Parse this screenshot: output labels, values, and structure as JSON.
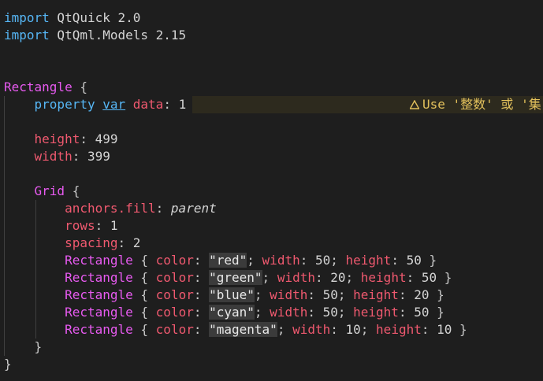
{
  "editor": {
    "warning_text": "Use '整数' 或 '集",
    "lines": [
      {
        "tokens": [
          [
            "kw",
            "import"
          ],
          [
            "id",
            " QtQuick 2.0"
          ]
        ]
      },
      {
        "tokens": [
          [
            "kw",
            "import"
          ],
          [
            "id",
            " QtQml.Models 2.15"
          ]
        ]
      },
      {
        "tokens": []
      },
      {
        "tokens": []
      },
      {
        "tokens": [
          [
            "type",
            "Rectangle"
          ],
          [
            "punc",
            " {"
          ]
        ]
      },
      {
        "tokens": [
          [
            "id",
            "    "
          ],
          [
            "pkw",
            "property"
          ],
          [
            "id",
            " "
          ],
          [
            "var",
            "var"
          ],
          [
            "id",
            " "
          ],
          [
            "prop",
            "data"
          ],
          [
            "punc",
            ": "
          ],
          [
            "num",
            "1"
          ]
        ]
      },
      {
        "tokens": []
      },
      {
        "tokens": [
          [
            "id",
            "    "
          ],
          [
            "prop",
            "height"
          ],
          [
            "punc",
            ": "
          ],
          [
            "num",
            "499"
          ]
        ]
      },
      {
        "tokens": [
          [
            "id",
            "    "
          ],
          [
            "prop",
            "width"
          ],
          [
            "punc",
            ": "
          ],
          [
            "num",
            "399"
          ]
        ]
      },
      {
        "tokens": []
      },
      {
        "tokens": [
          [
            "id",
            "    "
          ],
          [
            "type",
            "Grid"
          ],
          [
            "punc",
            " {"
          ]
        ]
      },
      {
        "tokens": [
          [
            "id",
            "        "
          ],
          [
            "prop",
            "anchors.fill"
          ],
          [
            "punc",
            ": "
          ],
          [
            "parent",
            "parent"
          ]
        ]
      },
      {
        "tokens": [
          [
            "id",
            "        "
          ],
          [
            "prop",
            "rows"
          ],
          [
            "punc",
            ": "
          ],
          [
            "num",
            "1"
          ]
        ]
      },
      {
        "tokens": [
          [
            "id",
            "        "
          ],
          [
            "prop",
            "spacing"
          ],
          [
            "punc",
            ": "
          ],
          [
            "num",
            "2"
          ]
        ]
      },
      {
        "tokens": [
          [
            "id",
            "        "
          ],
          [
            "type",
            "Rectangle"
          ],
          [
            "punc",
            " { "
          ],
          [
            "prop",
            "color"
          ],
          [
            "punc",
            ": "
          ],
          [
            "str",
            "\"red\""
          ],
          [
            "punc",
            "; "
          ],
          [
            "prop",
            "width"
          ],
          [
            "punc",
            ": "
          ],
          [
            "num",
            "50"
          ],
          [
            "punc",
            "; "
          ],
          [
            "prop",
            "height"
          ],
          [
            "punc",
            ": "
          ],
          [
            "num",
            "50"
          ],
          [
            "punc",
            " }"
          ]
        ]
      },
      {
        "tokens": [
          [
            "id",
            "        "
          ],
          [
            "type",
            "Rectangle"
          ],
          [
            "punc",
            " { "
          ],
          [
            "prop",
            "color"
          ],
          [
            "punc",
            ": "
          ],
          [
            "str",
            "\"green\""
          ],
          [
            "punc",
            "; "
          ],
          [
            "prop",
            "width"
          ],
          [
            "punc",
            ": "
          ],
          [
            "num",
            "20"
          ],
          [
            "punc",
            "; "
          ],
          [
            "prop",
            "height"
          ],
          [
            "punc",
            ": "
          ],
          [
            "num",
            "50"
          ],
          [
            "punc",
            " }"
          ]
        ]
      },
      {
        "tokens": [
          [
            "id",
            "        "
          ],
          [
            "type",
            "Rectangle"
          ],
          [
            "punc",
            " { "
          ],
          [
            "prop",
            "color"
          ],
          [
            "punc",
            ": "
          ],
          [
            "str",
            "\"blue\""
          ],
          [
            "punc",
            "; "
          ],
          [
            "prop",
            "width"
          ],
          [
            "punc",
            ": "
          ],
          [
            "num",
            "50"
          ],
          [
            "punc",
            "; "
          ],
          [
            "prop",
            "height"
          ],
          [
            "punc",
            ": "
          ],
          [
            "num",
            "20"
          ],
          [
            "punc",
            " }"
          ]
        ]
      },
      {
        "tokens": [
          [
            "id",
            "        "
          ],
          [
            "type",
            "Rectangle"
          ],
          [
            "punc",
            " { "
          ],
          [
            "prop",
            "color"
          ],
          [
            "punc",
            ": "
          ],
          [
            "str",
            "\"cyan\""
          ],
          [
            "punc",
            "; "
          ],
          [
            "prop",
            "width"
          ],
          [
            "punc",
            ": "
          ],
          [
            "num",
            "50"
          ],
          [
            "punc",
            "; "
          ],
          [
            "prop",
            "height"
          ],
          [
            "punc",
            ": "
          ],
          [
            "num",
            "50"
          ],
          [
            "punc",
            " }"
          ]
        ]
      },
      {
        "tokens": [
          [
            "id",
            "        "
          ],
          [
            "type",
            "Rectangle"
          ],
          [
            "punc",
            " { "
          ],
          [
            "prop",
            "color"
          ],
          [
            "punc",
            ": "
          ],
          [
            "str",
            "\"magenta\""
          ],
          [
            "punc",
            "; "
          ],
          [
            "prop",
            "width"
          ],
          [
            "punc",
            ": "
          ],
          [
            "num",
            "10"
          ],
          [
            "punc",
            "; "
          ],
          [
            "prop",
            "height"
          ],
          [
            "punc",
            ": "
          ],
          [
            "num",
            "10"
          ],
          [
            "punc",
            " }"
          ]
        ]
      },
      {
        "tokens": [
          [
            "id",
            "    "
          ],
          [
            "punc",
            "}"
          ]
        ]
      },
      {
        "tokens": [
          [
            "punc",
            "}"
          ]
        ]
      }
    ]
  }
}
